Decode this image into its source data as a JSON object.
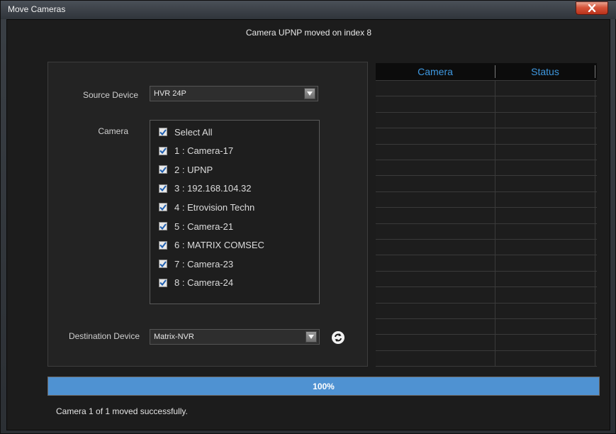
{
  "window": {
    "title": "Move Cameras"
  },
  "status_message": "Camera UPNP moved on index 8",
  "source": {
    "label": "Source Device",
    "value": "HVR 24P"
  },
  "camera": {
    "label": "Camera",
    "items": [
      {
        "text": "Select All",
        "checked": true
      },
      {
        "text": "1 : Camera-17",
        "checked": true
      },
      {
        "text": "2 : UPNP",
        "checked": true
      },
      {
        "text": "3 : 192.168.104.32",
        "checked": true
      },
      {
        "text": "4 : Etrovision Techn",
        "checked": true
      },
      {
        "text": "5 : Camera-21",
        "checked": true
      },
      {
        "text": "6 : MATRIX COMSEC",
        "checked": true
      },
      {
        "text": "7 : Camera-23",
        "checked": true
      },
      {
        "text": "8 : Camera-24",
        "checked": true
      }
    ]
  },
  "destination": {
    "label": "Destination Device",
    "value": "Matrix-NVR"
  },
  "grid": {
    "col_camera": "Camera",
    "col_status": "Status"
  },
  "progress": {
    "value": 1.0,
    "label": "100%"
  },
  "footer_status": "Camera 1 of 1 moved successfully.",
  "colors": {
    "accent": "#4f92d2",
    "header_text": "#3e98e0",
    "close": "#d5543a"
  }
}
